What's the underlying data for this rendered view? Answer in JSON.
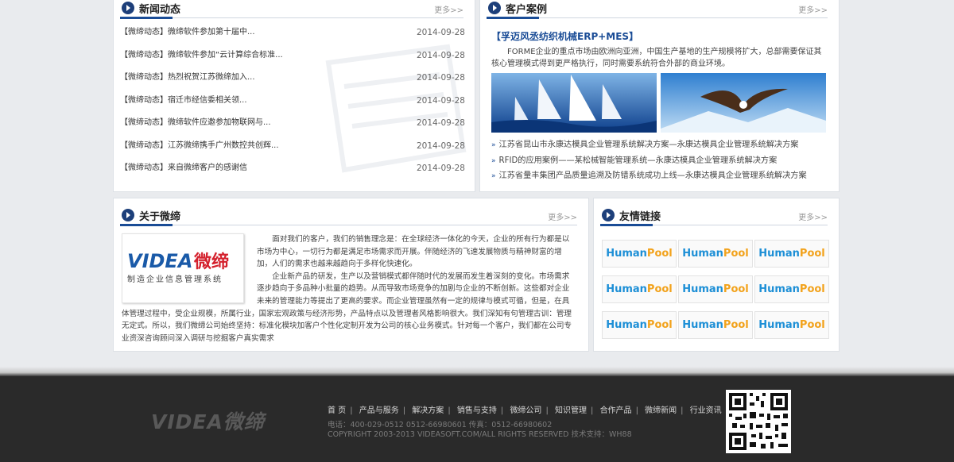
{
  "news": {
    "title": "新闻动态",
    "more": "更多>>",
    "items": [
      {
        "text": "【微缔动态】微缔软件参加第十届中...",
        "date": "2014-09-28"
      },
      {
        "text": "【微缔动态】微缔软件参加“云计算综合标准...",
        "date": "2014-09-28"
      },
      {
        "text": "【微缔动态】热烈祝贺江苏微缔加入...",
        "date": "2014-09-28"
      },
      {
        "text": "【微缔动态】宿迁市经信委相关领...",
        "date": "2014-09-28"
      },
      {
        "text": "【微缔动态】微缔软件应邀参加物联网与...",
        "date": "2014-09-28"
      },
      {
        "text": "【微缔动态】江苏微缔携手广州数控共创辉...",
        "date": "2014-09-28"
      },
      {
        "text": "【微缔动态】来自微缔客户的感谢信",
        "date": "2014-09-28"
      }
    ]
  },
  "cases": {
    "title": "客户案例",
    "more": "更多>>",
    "feature_title": "【孚迈风丞纺织机械ERP+MES】",
    "feature_desc": "FORME企业的重点市场由欧洲向亚洲，中国生产基地的生产规模将扩大，总部需要保证其核心管理模式得到更严格执行，同时需要系统符合外部的商业环境。",
    "links": [
      "江苏省昆山市永康达模具企业管理系统解决方案—永康达模具企业管理系统解决方案",
      "RFID的应用案例——某松械智能管理系统—永康达模具企业管理系统解决方案",
      "江苏省量丰集团产品质量追溯及防错系统成功上线—永康达模具企业管理系统解决方案"
    ]
  },
  "about": {
    "title": "关于微缔",
    "more": "更多>>",
    "logo_tagline": "制造企业信息管理系统",
    "paragraphs": [
      "面对我们的客户，我们的销售理念是：在全球经济一体化的今天，企业的所有行为都是以市场为中心，一切行为都是满足市场需求而开展。伴随经济的飞速发展物质与精神财富的增加，人们的需求也越来越趋向于多样化快速化。",
      "企业新产品的研发，生产以及营销模式都伴随时代的发展而发生着深刻的变化。市场需求逐步趋向于多品种小批量的趋势。从而导致市场竞争的加剧与企业的不断创新。这些都对企业未来的管理能力等提出了更高的要求。而企业管理虽然有一定的规律与模式可循，但是，在具体管理过程中，受企业规模，所属行业，国家宏观政策与经济形势，产品特点以及管理者风格影响很大。我们深知有句管理古训：管理无定式。所以，我们微缔公司始终坚持：标准化模块加客户个性化定制开发为公司的核心业务模式。针对每一个客户，我们都在公司专业资深咨询顾问深入调研与挖掘客户真实需求"
    ]
  },
  "friends": {
    "title": "友情链接",
    "more": "更多>>",
    "logo_part1": "Human",
    "logo_part2": "Pool"
  },
  "footer": {
    "nav": [
      "首 页",
      "产品与服务",
      "解决方案",
      "销售与支持",
      "微缔公司",
      "知识管理",
      "合作产品",
      "微缔新闻",
      "行业资讯"
    ],
    "phone": "电话：400-029-0512 0512-66980601 传真：0512-66980602",
    "copyright": "COPYRIGHT 2003-2013  VIDEASOFT.COM/ALL RIGHTS RESERVED  技术支持：WH88"
  },
  "colors": {
    "accent": "#1a4c96",
    "footer_bg": "#2a2a2a"
  }
}
